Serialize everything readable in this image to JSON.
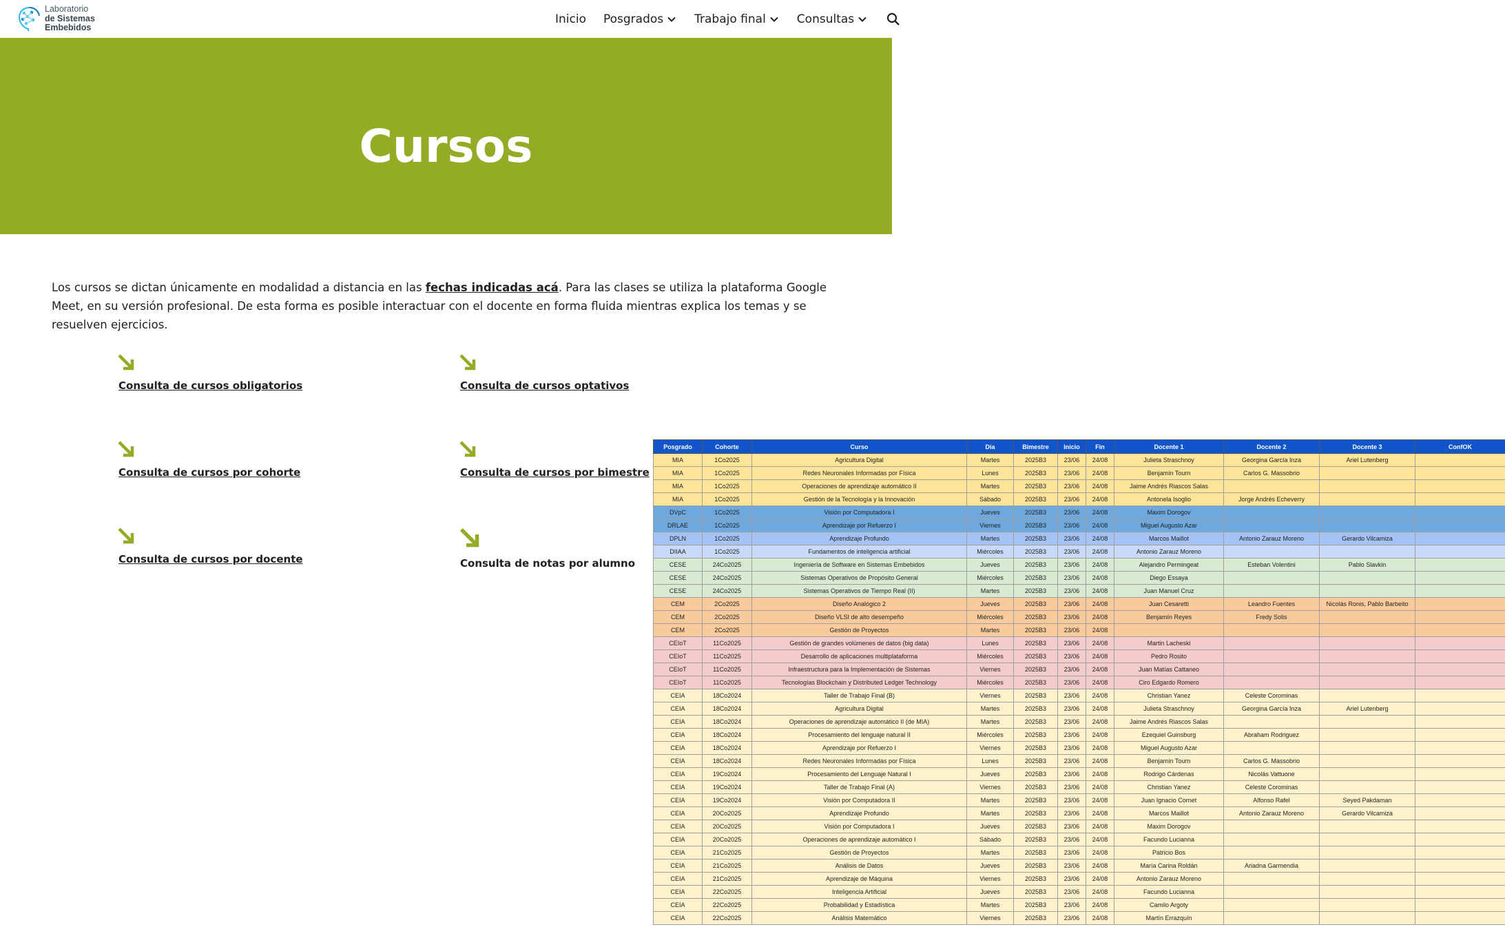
{
  "header": {
    "logo": {
      "line1": "Laboratorio",
      "line2": "de Sistemas",
      "line3": "Embebidos",
      "icon": "brain-circuit-logo"
    },
    "nav": [
      {
        "label": "Inicio",
        "dropdown": false
      },
      {
        "label": "Posgrados",
        "dropdown": true
      },
      {
        "label": "Trabajo final",
        "dropdown": true
      },
      {
        "label": "Consultas",
        "dropdown": true
      }
    ],
    "search_icon": "search-icon"
  },
  "hero": {
    "title": "Cursos",
    "background": "#93ab25"
  },
  "intro": {
    "before_link": "Los cursos se dictan únicamente en modalidad a distancia en las ",
    "link": "fechas indicadas acá",
    "after_link": ". Para las clases se utiliza la plataforma Google Meet, en su versión profesional. De esta forma es posible interactuar con el docente en forma fluida mientras explica los temas y se resuelven ejercicios."
  },
  "quick_links": [
    {
      "label": "Consulta de cursos obligatorios",
      "icon": "arrow-down-right-icon"
    },
    {
      "label": "Consulta de cursos optativos",
      "icon": "arrow-down-right-icon"
    },
    {
      "label": "Consulta de cursos por cohorte",
      "icon": "arrow-down-right-icon"
    },
    {
      "label": "Consulta de cursos por bimestre",
      "icon": "arrow-down-right-icon"
    },
    {
      "label": "Consulta de cursos por docente",
      "icon": "arrow-down-right-icon"
    },
    {
      "label": "Consulta de notas por alumno",
      "icon": "arrow-down-right-icon"
    }
  ],
  "colors": {
    "accent_green": "#93ab25",
    "sheet_header": "#1155cc",
    "MIA": "#ffe599",
    "DVpC": "#6fa8dc",
    "DRLAE": "#6fa8dc",
    "DPLN": "#a4c2f4",
    "DIIAA": "#c9daf8",
    "CESE": "#d9ead3",
    "CEM": "#f9cb9c",
    "CEIoT": "#f4cccc",
    "CEIA": "#fff2cc"
  },
  "schedule": {
    "columns": [
      "Posgrado",
      "Cohorte",
      "Curso",
      "Día",
      "Bimestre",
      "Inicio",
      "Fin",
      "Docente 1",
      "Docente 2",
      "Docente 3",
      "ConfOK"
    ],
    "rows": [
      [
        "MIA",
        "1Co2025",
        "Agricultura Digital",
        "Martes",
        "2025B3",
        "23/06",
        "24/08",
        "Julieta Straschnoy",
        "Georgina García Inza",
        "Ariel Lutenberg",
        ""
      ],
      [
        "MIA",
        "1Co2025",
        "Redes Neuronales Informadas por Física",
        "Lunes",
        "2025B3",
        "23/06",
        "24/08",
        "Benjamín Tourn",
        "Carlos G. Massobrio",
        "",
        ""
      ],
      [
        "MIA",
        "1Co2025",
        "Operaciones de aprendizaje automático II",
        "Martes",
        "2025B3",
        "23/06",
        "24/08",
        "Jaime Andrés Riascos Salas",
        "",
        "",
        ""
      ],
      [
        "MIA",
        "1Co2025",
        "Gestión de la Tecnología y la Innovación",
        "Sábado",
        "2025B3",
        "23/06",
        "24/08",
        "Antonela Isoglio",
        "Jorge Andrés Echeverry",
        "",
        ""
      ],
      [
        "DVpC",
        "1Co2025",
        "Visión por Computadora I",
        "Jueves",
        "2025B3",
        "23/06",
        "24/08",
        "Maxim Dorogov",
        "",
        "",
        ""
      ],
      [
        "DRLAE",
        "1Co2025",
        "Aprendizaje por Refuerzo I",
        "Viernes",
        "2025B3",
        "23/06",
        "24/08",
        "Miguel Augusto Azar",
        "",
        "",
        ""
      ],
      [
        "DPLN",
        "1Co2025",
        "Aprendizaje Profundo",
        "Martes",
        "2025B3",
        "23/06",
        "24/08",
        "Marcos Maillot",
        "Antonio Zarauz Moreno",
        "Gerardo Vilcamiza",
        ""
      ],
      [
        "DIIAA",
        "1Co2025",
        "Fundamentos de inteligencia artificial",
        "Miércoles",
        "2025B3",
        "23/06",
        "24/08",
        "Antonio Zarauz Moreno",
        "",
        "",
        ""
      ],
      [
        "CESE",
        "24Co2025",
        "Ingeniería de Software en Sistemas Embebidos",
        "Jueves",
        "2025B3",
        "23/06",
        "24/08",
        "Alejandro Permingeat",
        "Esteban Volentini",
        "Pablo Slavkin",
        ""
      ],
      [
        "CESE",
        "24Co2025",
        "Sistemas Operativos de Propósito General",
        "Miércoles",
        "2025B3",
        "23/06",
        "24/08",
        "Diego Essaya",
        "",
        "",
        ""
      ],
      [
        "CESE",
        "24Co2025",
        "Sistemas Operativos de Tiempo Real (II)",
        "Martes",
        "2025B3",
        "23/06",
        "24/08",
        "Juan Manuel Cruz",
        "",
        "",
        ""
      ],
      [
        "CEM",
        "2Co2025",
        "Diseño Analógico 2",
        "Jueves",
        "2025B3",
        "23/06",
        "24/08",
        "Juan Cesaretti",
        "Leandro Fuentes",
        "Nicolás Ronis, Pablo Barbeito",
        ""
      ],
      [
        "CEM",
        "2Co2025",
        "Diseño VLSI de alto desempeño",
        "Miércoles",
        "2025B3",
        "23/06",
        "24/08",
        "Benjamín Reyes",
        "Fredy Solis",
        "",
        ""
      ],
      [
        "CEM",
        "2Co2025",
        "Gestión de Proyectos",
        "Martes",
        "2025B3",
        "23/06",
        "24/08",
        "",
        "",
        "",
        ""
      ],
      [
        "CEIoT",
        "11Co2025",
        "Gestión de grandes volúmenes de datos (big data)",
        "Lunes",
        "2025B3",
        "23/06",
        "24/08",
        "Martin Lacheski",
        "",
        "",
        ""
      ],
      [
        "CEIoT",
        "11Co2025",
        "Desarrollo de aplicaciones multiplataforma",
        "Miércoles",
        "2025B3",
        "23/06",
        "24/08",
        "Pedro Rosito",
        "",
        "",
        ""
      ],
      [
        "CEIoT",
        "11Co2025",
        "Infraestructura para la Implementación de Sistemas",
        "Viernes",
        "2025B3",
        "23/06",
        "24/08",
        "Juan Matías Cattaneo",
        "",
        "",
        ""
      ],
      [
        "CEIoT",
        "11Co2025",
        "Tecnologías Blockchain y Distributed Ledger Technology",
        "Miércoles",
        "2025B3",
        "23/06",
        "24/08",
        "Ciro Edgardo Romero",
        "",
        "",
        ""
      ],
      [
        "CEIA",
        "18Co2024",
        "Taller de Trabajo Final (B)",
        "Viernes",
        "2025B3",
        "23/06",
        "24/08",
        "Christian Yanez",
        "Celeste Corominas",
        "",
        ""
      ],
      [
        "CEIA",
        "18Co2024",
        "Agricultura Digital",
        "Martes",
        "2025B3",
        "23/06",
        "24/08",
        "Julieta Straschnoy",
        "Georgina García Inza",
        "Ariel Lutenberg",
        ""
      ],
      [
        "CEIA",
        "18Co2024",
        "Operaciones de aprendizaje automático II (de MIA)",
        "Martes",
        "2025B3",
        "23/06",
        "24/08",
        "Jaime Andrés Riascos Salas",
        "",
        "",
        ""
      ],
      [
        "CEIA",
        "18Co2024",
        "Procesamiento del lenguaje natural II",
        "Miércoles",
        "2025B3",
        "23/06",
        "24/08",
        "Ezequiel Guinsburg",
        "Abraham Rodriguez",
        "",
        ""
      ],
      [
        "CEIA",
        "18Co2024",
        "Aprendizaje por Refuerzo I",
        "Viernes",
        "2025B3",
        "23/06",
        "24/08",
        "Miguel Augusto Azar",
        "",
        "",
        ""
      ],
      [
        "CEIA",
        "18Co2024",
        "Redes Neuronales Informadas por Física",
        "Lunes",
        "2025B3",
        "23/06",
        "24/08",
        "Benjamín Tourn",
        "Carlos G. Massobrio",
        "",
        ""
      ],
      [
        "CEIA",
        "19Co2024",
        "Procesamiento del Lenguaje Natural I",
        "Jueves",
        "2025B3",
        "23/06",
        "24/08",
        "Rodrigo Cárdenas",
        "Nicolás Vattuone",
        "",
        ""
      ],
      [
        "CEIA",
        "19Co2024",
        "Taller de Trabajo Final (A)",
        "Viernes",
        "2025B3",
        "23/06",
        "24/08",
        "Christian Yanez",
        "Celeste Corominas",
        "",
        ""
      ],
      [
        "CEIA",
        "19Co2024",
        "Visión por Computadora II",
        "Martes",
        "2025B3",
        "23/06",
        "24/08",
        "Juan Ignacio Cornet",
        "Alfonso Rafel",
        "Seyed Pakdaman",
        ""
      ],
      [
        "CEIA",
        "20Co2025",
        "Aprendizaje Profundo",
        "Martes",
        "2025B3",
        "23/06",
        "24/08",
        "Marcos Maillot",
        "Antonio Zarauz Moreno",
        "Gerardo Vilcamiza",
        ""
      ],
      [
        "CEIA",
        "20Co2025",
        "Visión por Computadora I",
        "Jueves",
        "2025B3",
        "23/06",
        "24/08",
        "Maxim Dorogov",
        "",
        "",
        ""
      ],
      [
        "CEIA",
        "20Co2025",
        "Operaciones de aprendizaje automático I",
        "Sábado",
        "2025B3",
        "23/06",
        "24/08",
        "Facundo Lucianna",
        "",
        "",
        ""
      ],
      [
        "CEIA",
        "21Co2025",
        "Gestión de Proyectos",
        "Martes",
        "2025B3",
        "23/06",
        "24/08",
        "Patricio Bos",
        "",
        "",
        ""
      ],
      [
        "CEIA",
        "21Co2025",
        "Análisis de Datos",
        "Jueves",
        "2025B3",
        "23/06",
        "24/08",
        "María Carina Roldán",
        "Ariadna Garmendia",
        "",
        ""
      ],
      [
        "CEIA",
        "21Co2025",
        "Aprendizaje de Máquina",
        "Viernes",
        "2025B3",
        "23/06",
        "24/08",
        "Antonio Zarauz Moreno",
        "",
        "",
        ""
      ],
      [
        "CEIA",
        "22Co2025",
        "Inteligencia Artificial",
        "Jueves",
        "2025B3",
        "23/06",
        "24/08",
        "Facundo Lucianna",
        "",
        "",
        ""
      ],
      [
        "CEIA",
        "22Co2025",
        "Probabilidad y Estadística",
        "Martes",
        "2025B3",
        "23/06",
        "24/08",
        "Camilo Argoty",
        "",
        "",
        ""
      ],
      [
        "CEIA",
        "22Co2025",
        "Análisis Matemático",
        "Viernes",
        "2025B3",
        "23/06",
        "24/08",
        "Martín Errazquín",
        "",
        "",
        ""
      ]
    ]
  }
}
